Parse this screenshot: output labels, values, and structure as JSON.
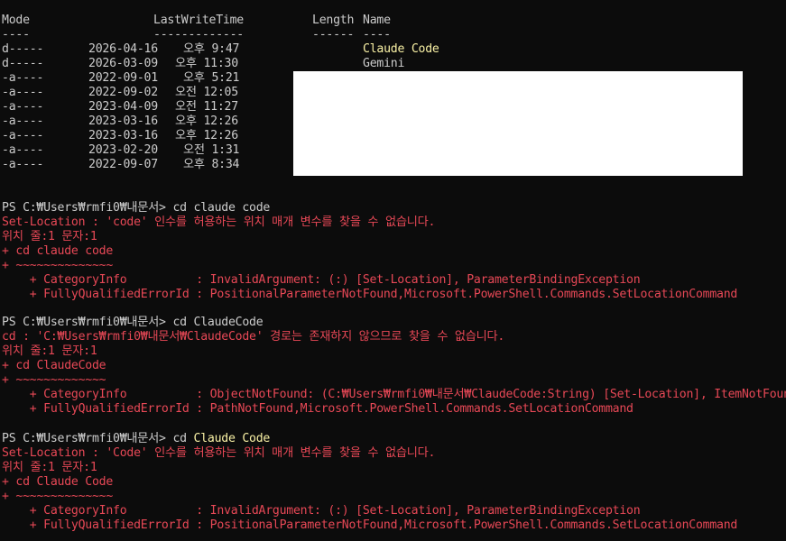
{
  "listing": {
    "header": {
      "mode": "Mode",
      "lastwrite": "LastWriteTime",
      "length": "Length",
      "name": "Name"
    },
    "separator": {
      "mode": "----",
      "lastwrite": "-------------",
      "length": "------",
      "name": "----"
    },
    "rows": [
      {
        "mode": "d-----",
        "date": "2026-04-16",
        "time": "오후 9:47",
        "name": "Claude Code",
        "highlight": true
      },
      {
        "mode": "d-----",
        "date": "2026-03-09",
        "time": "오후 11:30",
        "name": "Gemini",
        "highlight": false
      },
      {
        "mode": "-a----",
        "date": "2022-09-01",
        "time": "오후 5:21",
        "name": ""
      },
      {
        "mode": "-a----",
        "date": "2022-09-02",
        "time": "오전 12:05",
        "name": ""
      },
      {
        "mode": "-a----",
        "date": "2023-04-09",
        "time": "오전 11:27",
        "name": ""
      },
      {
        "mode": "-a----",
        "date": "2023-03-16",
        "time": "오후 12:26",
        "name": ""
      },
      {
        "mode": "-a----",
        "date": "2023-03-16",
        "time": "오후 12:26",
        "name": ""
      },
      {
        "mode": "-a----",
        "date": "2023-02-20",
        "time": "오전 1:31",
        "name": ""
      },
      {
        "mode": "-a----",
        "date": "2022-09-07",
        "time": "오후 8:34",
        "name": ""
      }
    ]
  },
  "block1": {
    "prompt": "PS C:₩Users₩rmfi0₩내문서> ",
    "command": "cd claude code",
    "error": "Set-Location : 'code' 인수를 허용하는 위치 매개 변수를 찾을 수 없습니다.",
    "position": "위치 줄:1 문자:1",
    "echo": "+ cd claude code",
    "tilde": "+ ~~~~~~~~~~~~~~",
    "category": "    + CategoryInfo          : InvalidArgument: (:) [Set-Location], ParameterBindingException",
    "fqid": "    + FullyQualifiedErrorId : PositionalParameterNotFound,Microsoft.PowerShell.Commands.SetLocationCommand"
  },
  "block2": {
    "prompt": "PS C:₩Users₩rmfi0₩내문서> ",
    "command": "cd ClaudeCode",
    "error": "cd : 'C:₩Users₩rmfi0₩내문서₩ClaudeCode' 경로는 존재하지 않으므로 찾을 수 없습니다.",
    "position": "위치 줄:1 문자:1",
    "echo": "+ cd ClaudeCode",
    "tilde": "+ ~~~~~~~~~~~~~",
    "category": "    + CategoryInfo          : ObjectNotFound: (C:₩Users₩rmfi0₩내문서₩ClaudeCode:String) [Set-Location], ItemNotFoundException",
    "fqid": "    + FullyQualifiedErrorId : PathNotFound,Microsoft.PowerShell.Commands.SetLocationCommand"
  },
  "block3": {
    "prompt": "PS C:₩Users₩rmfi0₩내문서> ",
    "command_cd": "cd ",
    "command_arg": "Claude Code",
    "error": "Set-Location : 'Code' 인수를 허용하는 위치 매개 변수를 찾을 수 없습니다.",
    "position": "위치 줄:1 문자:1",
    "echo": "+ cd Claude Code",
    "tilde": "+ ~~~~~~~~~~~~~~",
    "category": "    + CategoryInfo          : InvalidArgument: (:) [Set-Location], ParameterBindingException",
    "fqid": "    + FullyQualifiedErrorId : PositionalParameterNotFound,Microsoft.PowerShell.Commands.SetLocationCommand"
  },
  "colors": {
    "background": "#0c0c0c",
    "text": "#cccccc",
    "error": "#e74856",
    "highlight": "#f9f1a5",
    "redaction": "#ffffff"
  }
}
